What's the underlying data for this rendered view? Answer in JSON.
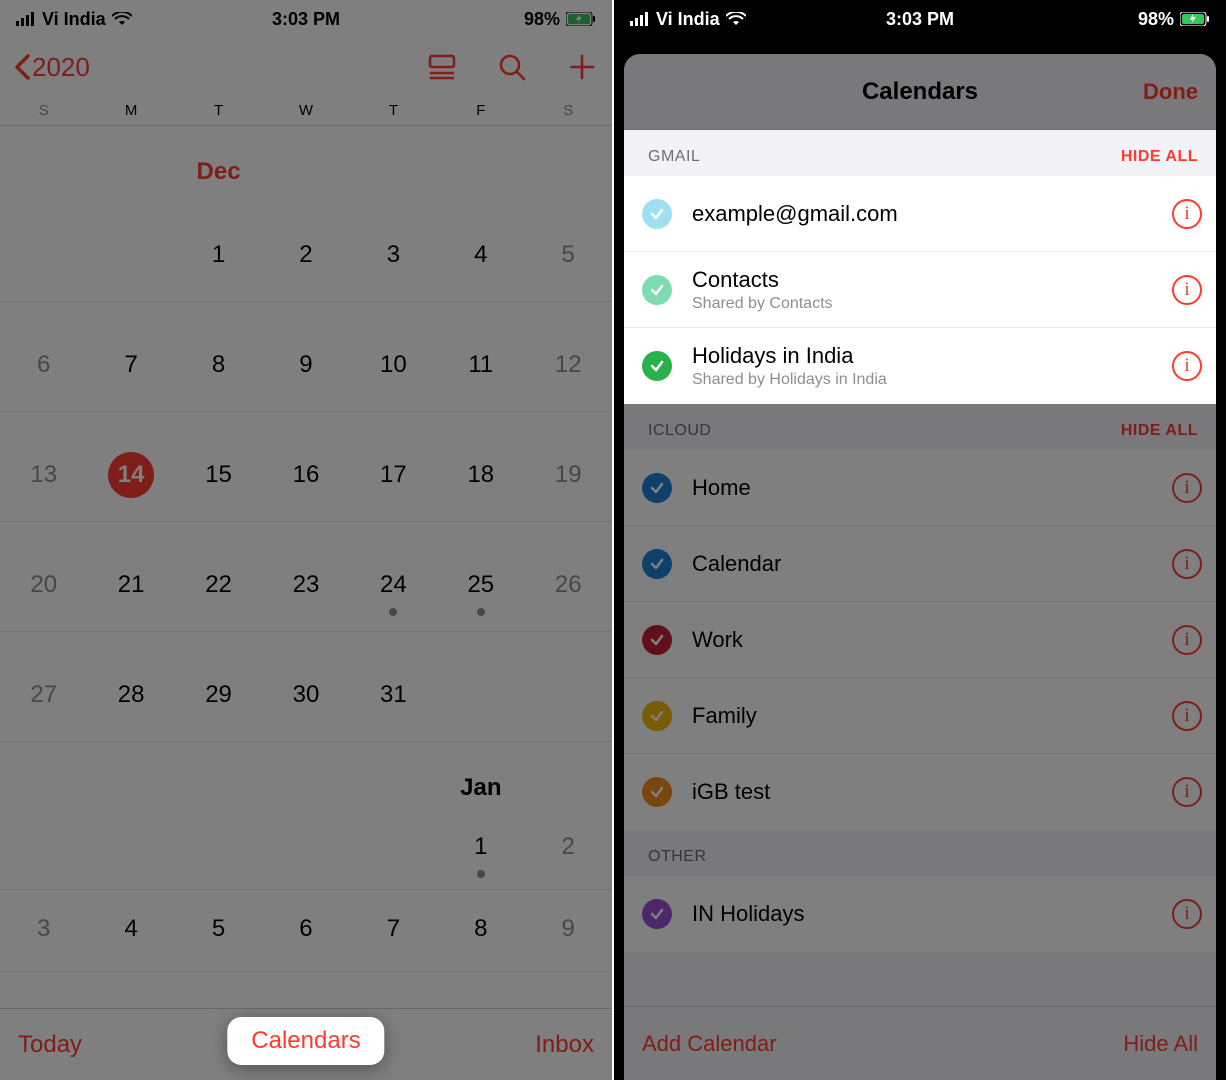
{
  "status": {
    "carrier": "Vi India",
    "time": "3:03 PM",
    "battery": "98%"
  },
  "left": {
    "back_label": "2020",
    "days": [
      "S",
      "M",
      "T",
      "W",
      "T",
      "F",
      "S"
    ],
    "month1": "Dec",
    "rows": [
      [
        "",
        "",
        "1",
        "2",
        "3",
        "4",
        "5"
      ],
      [
        "6",
        "7",
        "8",
        "9",
        "10",
        "11",
        "12"
      ],
      [
        "13",
        "14",
        "15",
        "16",
        "17",
        "18",
        "19"
      ],
      [
        "20",
        "21",
        "22",
        "23",
        "24",
        "25",
        "26"
      ],
      [
        "27",
        "28",
        "29",
        "30",
        "31",
        "",
        ""
      ]
    ],
    "today": "14",
    "dots": [
      "24",
      "25"
    ],
    "month2": "Jan",
    "rows2": [
      [
        "",
        "",
        "",
        "",
        "",
        "1",
        "2"
      ],
      [
        "3",
        "4",
        "5",
        "6",
        "7",
        "8",
        "9"
      ]
    ],
    "dots2": [
      "1"
    ],
    "bottom": {
      "today": "Today",
      "calendars": "Calendars",
      "inbox": "Inbox"
    }
  },
  "right": {
    "sheet_title": "Calendars",
    "done": "Done",
    "sections": [
      {
        "name": "GMAIL",
        "hide": "HIDE ALL",
        "highlight": true,
        "items": [
          {
            "label": "example@gmail.com",
            "sub": "",
            "color": "#9edff2"
          },
          {
            "label": "Contacts",
            "sub": "Shared by Contacts",
            "color": "#7fdcb0"
          },
          {
            "label": "Holidays in India",
            "sub": "Shared by Holidays in India",
            "color": "#29b24a"
          }
        ]
      },
      {
        "name": "ICLOUD",
        "hide": "HIDE ALL",
        "highlight": false,
        "items": [
          {
            "label": "Home",
            "sub": "",
            "color": "#1e7fd6"
          },
          {
            "label": "Calendar",
            "sub": "",
            "color": "#1e7fd6"
          },
          {
            "label": "Work",
            "sub": "",
            "color": "#c21f3a"
          },
          {
            "label": "Family",
            "sub": "",
            "color": "#f2b90c"
          },
          {
            "label": "iGB test",
            "sub": "",
            "color": "#f28c1e"
          }
        ]
      },
      {
        "name": "OTHER",
        "hide": "",
        "highlight": false,
        "items": [
          {
            "label": "IN Holidays",
            "sub": "",
            "color": "#9b4fd6"
          }
        ]
      }
    ],
    "bottom": {
      "add": "Add Calendar",
      "hideall": "Hide All"
    }
  }
}
